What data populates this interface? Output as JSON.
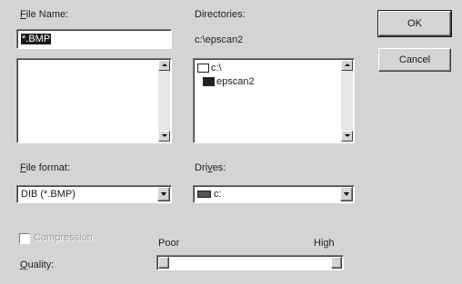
{
  "file_name": {
    "label_prefix": "F",
    "label_rest": "ile Name:",
    "value": "*.BMP"
  },
  "directories": {
    "label": "Directories:",
    "current_path": "c:\\epscan2",
    "items": [
      {
        "label": "c:\\"
      },
      {
        "label": "epscan2"
      }
    ]
  },
  "file_format": {
    "label_prefix": "F",
    "label_rest": "ile format:",
    "value": "DIB (*.BMP)"
  },
  "drives": {
    "label_prefix": "Dri",
    "label_underline": "v",
    "label_rest": "es:",
    "value": "c:"
  },
  "buttons": {
    "ok": "OK",
    "cancel": "Cancel"
  },
  "compression": {
    "label": "Compression",
    "checked": false,
    "enabled": false
  },
  "quality": {
    "label_underline": "Q",
    "label_rest": "uality:",
    "min_label": "Poor",
    "max_label": "High"
  },
  "icons": {
    "open_folder": "open-folder-icon",
    "closed_folder": "closed-folder-icon",
    "drive": "hard-drive-icon"
  }
}
